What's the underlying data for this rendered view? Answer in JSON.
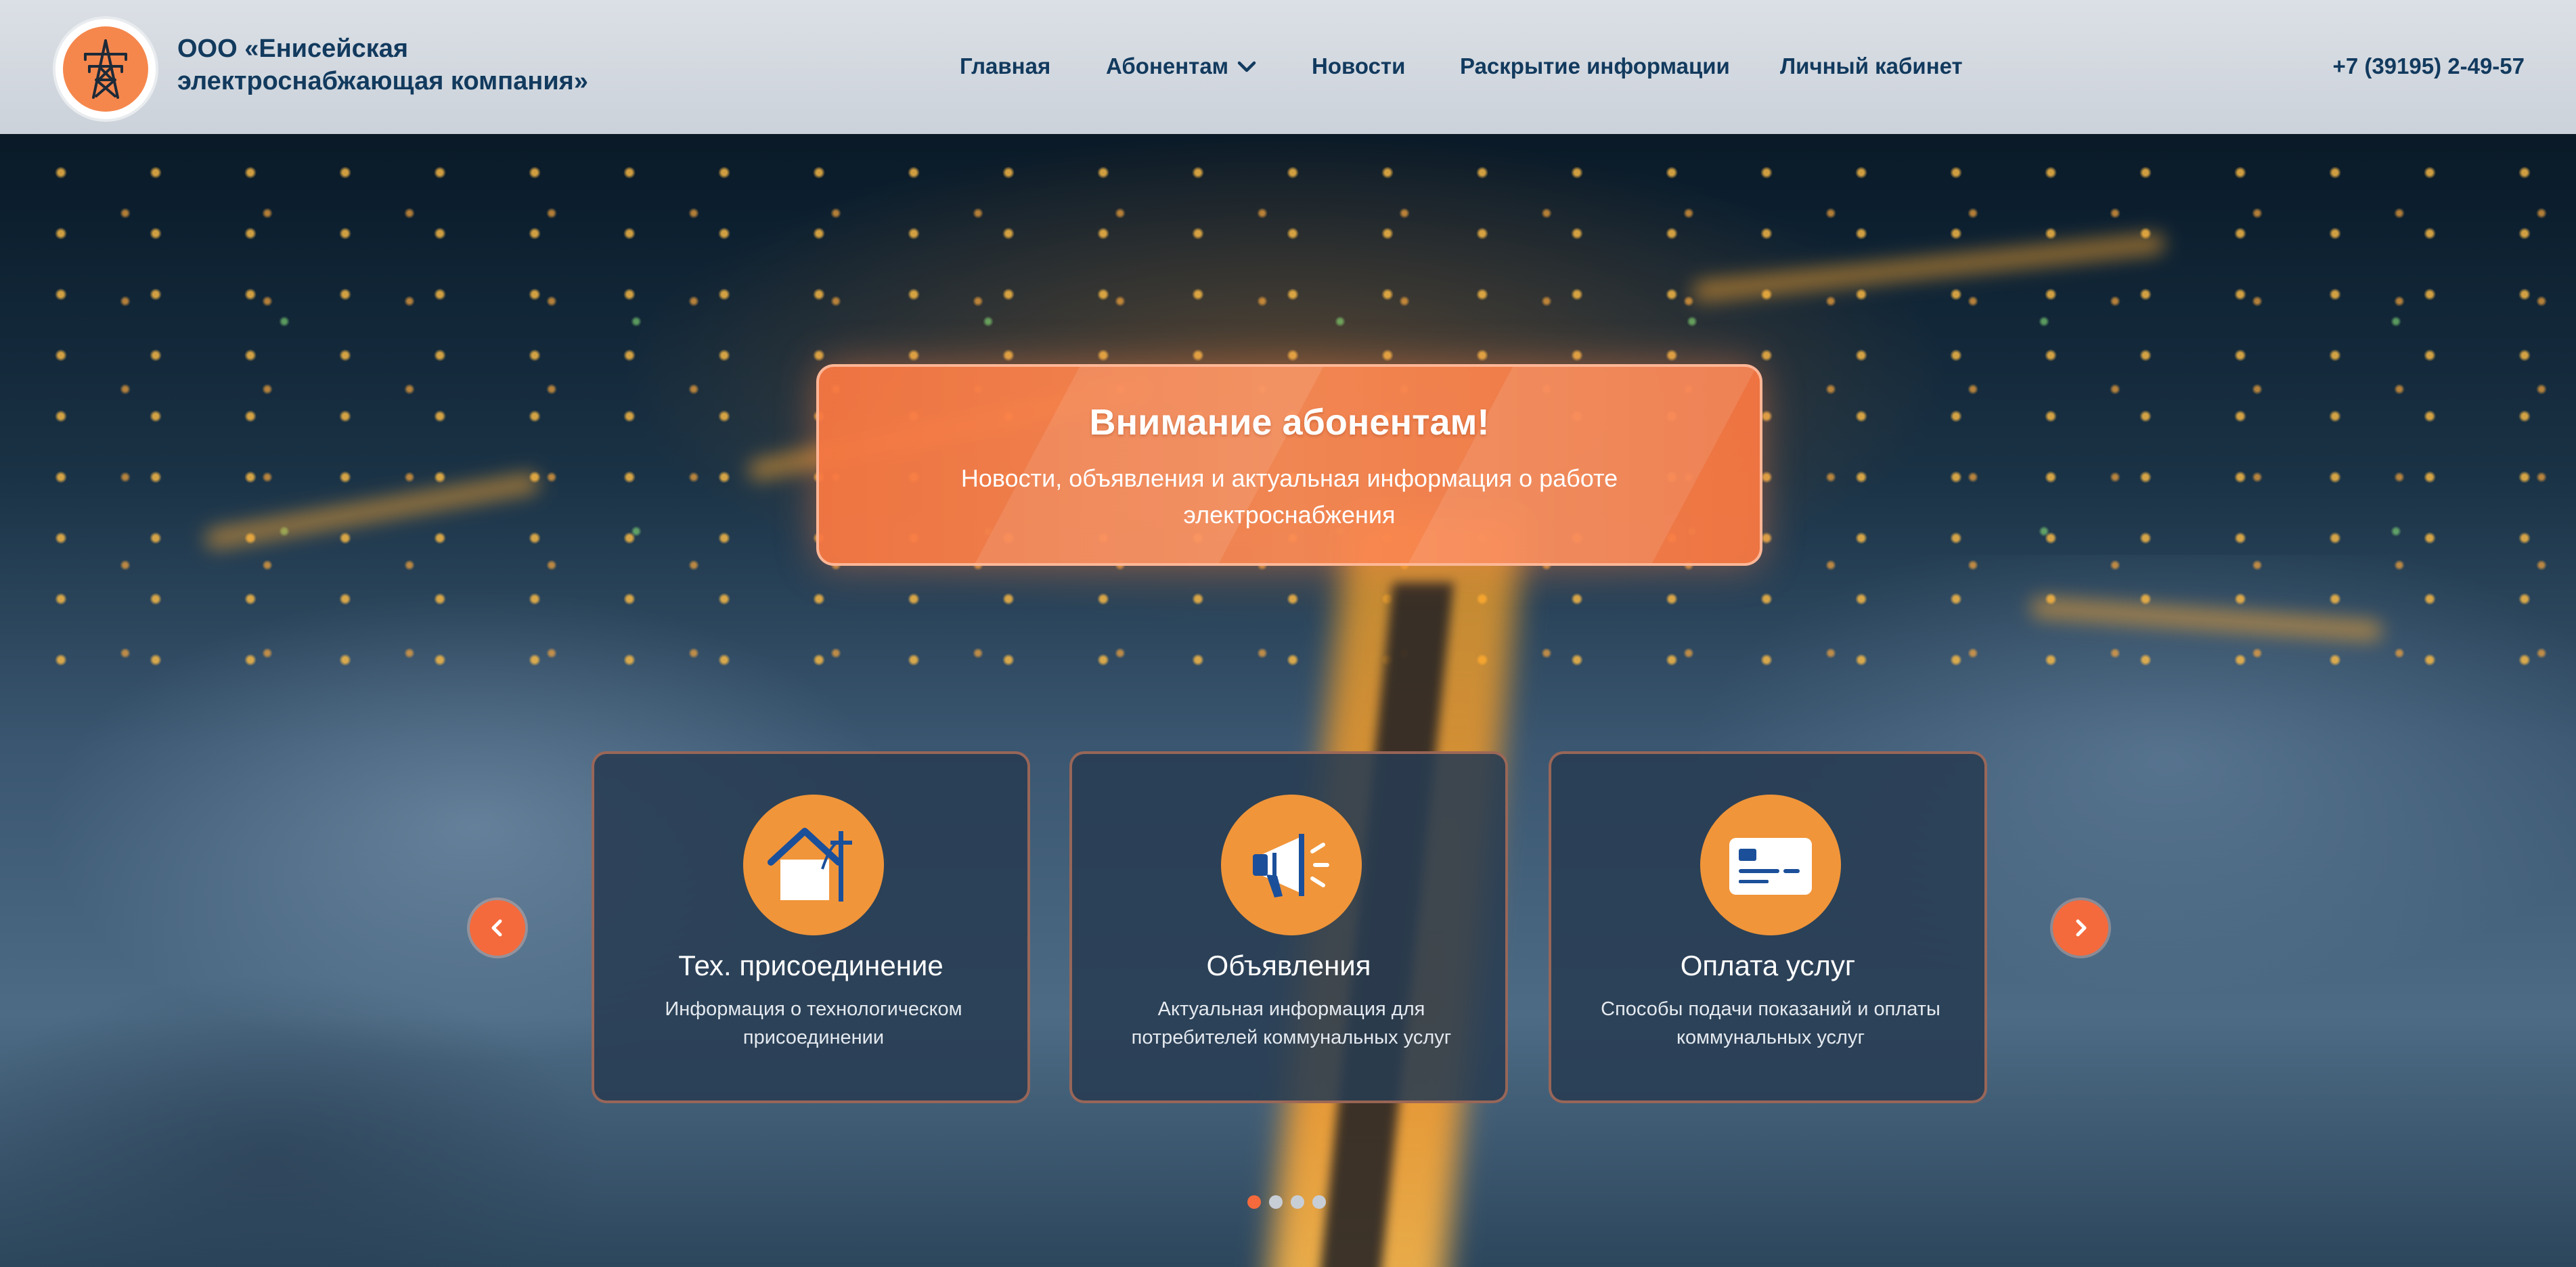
{
  "header": {
    "brand_line1": "ООО «Енисейская",
    "brand_line2": "электроснабжающая компания»",
    "logo_icon": "power-tower-icon",
    "phone": "+7 (39195) 2-49-57"
  },
  "nav": {
    "items": [
      {
        "label": "Главная"
      },
      {
        "label": "Абонентам",
        "has_dropdown": true,
        "dropdown_icon": "chevron-down-icon"
      },
      {
        "label": "Новости"
      },
      {
        "label": "Раскрытие информации"
      },
      {
        "label": "Личный кабинет"
      }
    ]
  },
  "alert": {
    "title": "Внимание абонентам!",
    "text": "Новости, объявления и актуальная информация о работе электроснабжения"
  },
  "cards": [
    {
      "icon": "house-power-icon",
      "title": "Тех. присоединение",
      "text": "Информация о технологическом присоединении"
    },
    {
      "icon": "megaphone-icon",
      "title": "Объявления",
      "text": "Актуальная информация для потребителей коммунальных услуг"
    },
    {
      "icon": "payment-card-icon",
      "title": "Оплата услуг",
      "text": "Способы подачи показаний и оплаты коммунальных услуг"
    }
  ],
  "carousel": {
    "slide_count": 4,
    "active_index": 0
  },
  "colors": {
    "brand_blue": "#123a5e",
    "accent_orange": "#f46a3c",
    "icon_orange": "#f0953a",
    "alert_orange": "#f8784a"
  }
}
